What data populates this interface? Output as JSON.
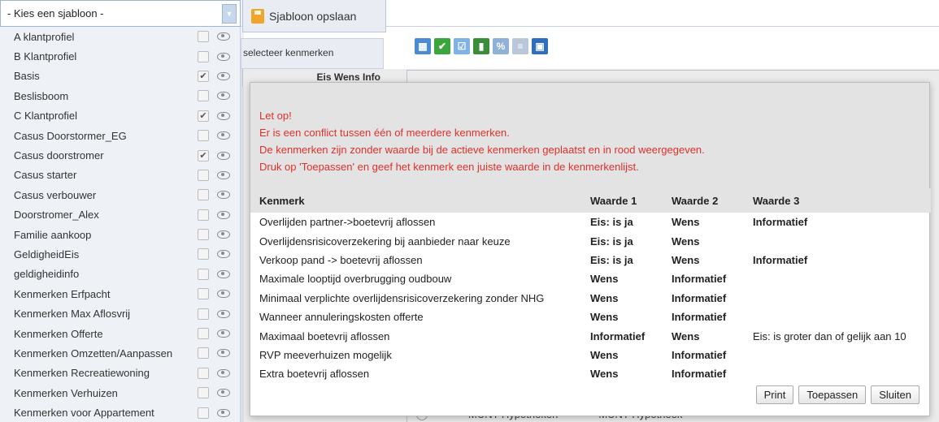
{
  "template_select": {
    "value": "- Kies een sjabloon -",
    "items": [
      {
        "label": "A klantprofiel",
        "checked": false
      },
      {
        "label": "B Klantprofiel",
        "checked": false
      },
      {
        "label": "Basis",
        "checked": true
      },
      {
        "label": "Beslisboom",
        "checked": false
      },
      {
        "label": "C Klantprofiel",
        "checked": true
      },
      {
        "label": "Casus Doorstormer_EG",
        "checked": false
      },
      {
        "label": "Casus doorstromer",
        "checked": true
      },
      {
        "label": "Casus starter",
        "checked": false
      },
      {
        "label": "Casus verbouwer",
        "checked": false
      },
      {
        "label": "Doorstromer_Alex",
        "checked": false
      },
      {
        "label": "Familie aankoop",
        "checked": false
      },
      {
        "label": "GeldigheidEis",
        "checked": false
      },
      {
        "label": "geldigheidinfo",
        "checked": false
      },
      {
        "label": "Kenmerken Erfpacht",
        "checked": false
      },
      {
        "label": "Kenmerken Max Aflosvrij",
        "checked": false
      },
      {
        "label": "Kenmerken Offerte",
        "checked": false
      },
      {
        "label": "Kenmerken Omzetten/Aanpassen",
        "checked": false
      },
      {
        "label": "Kenmerken Recreatiewoning",
        "checked": false
      },
      {
        "label": "Kenmerken Verhuizen",
        "checked": false
      },
      {
        "label": "Kenmerken voor Appartement",
        "checked": false
      }
    ]
  },
  "save_template_label": "Sjabloon opslaan",
  "background": {
    "select_features": "selecteer kenmerken",
    "col_headers": "Eis  Wens  Info",
    "bottom_row": [
      "MUNT Hypotheken",
      "MUNT Hypotheek"
    ]
  },
  "toolbar_icons": [
    "calculator-icon",
    "checkmark-icon",
    "checklist-icon",
    "bar-chart-icon",
    "percent-icon",
    "document-icon",
    "save-icon"
  ],
  "modal": {
    "warning_lines": [
      "Let op!",
      "Er is een conflict tussen één of meerdere kenmerken.",
      "De kenmerken zijn zonder waarde bij de actieve kenmerken geplaatst en in rood weergegeven.",
      "Druk op 'Toepassen' en geef het kenmerk een juiste waarde in de kenmerkenlijst."
    ],
    "columns": [
      "Kenmerk",
      "Waarde 1",
      "Waarde 2",
      "Waarde 3"
    ],
    "rows": [
      [
        "Overlijden partner->boetevrij aflossen",
        "Eis: is ja",
        "Wens",
        "Informatief"
      ],
      [
        "Overlijdensrisicoverzekering bij aanbieder naar keuze",
        "Eis: is ja",
        "Wens",
        ""
      ],
      [
        "Verkoop pand -> boetevrij aflossen",
        "Eis: is ja",
        "Wens",
        "Informatief"
      ],
      [
        "Maximale looptijd overbrugging oudbouw",
        "Wens",
        "Informatief",
        ""
      ],
      [
        "Minimaal verplichte overlijdensrisicoverzekering zonder NHG",
        "Wens",
        "Informatief",
        ""
      ],
      [
        "Wanneer annuleringskosten offerte",
        "Wens",
        "Informatief",
        ""
      ],
      [
        "Maximaal boetevrij aflossen",
        "Informatief",
        "Wens",
        "Eis: is groter dan of gelijk aan 10"
      ],
      [
        "RVP meeverhuizen mogelijk",
        "Wens",
        "Informatief",
        ""
      ],
      [
        "Extra boetevrij aflossen",
        "Wens",
        "Informatief",
        ""
      ]
    ],
    "buttons": {
      "print": "Print",
      "apply": "Toepassen",
      "close": "Sluiten"
    }
  }
}
